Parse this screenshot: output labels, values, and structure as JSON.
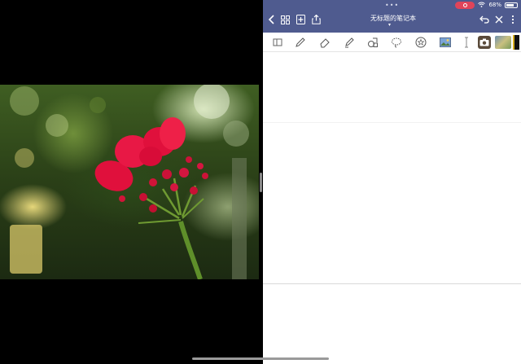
{
  "notes_app": {
    "title": "无标题的笔记本",
    "status": {
      "dots": "•••",
      "battery_text": "68%"
    }
  },
  "colors": {
    "nav_bar": "#4f5b8f",
    "recording": "#e0445a",
    "page": "#ffffff"
  },
  "icons": {
    "nav": [
      "chevron-left-icon",
      "grid-icon",
      "add-page-icon",
      "share-icon",
      "undo-icon",
      "close-icon"
    ],
    "tools": [
      "sidebar-toggle-icon",
      "pen-icon",
      "eraser-icon",
      "highlighter-icon",
      "shapes-icon",
      "lasso-icon",
      "star-sticker-icon",
      "image-icon",
      "text-cursor-icon",
      "camera-icon",
      "photo-thumbnail-icon"
    ]
  }
}
